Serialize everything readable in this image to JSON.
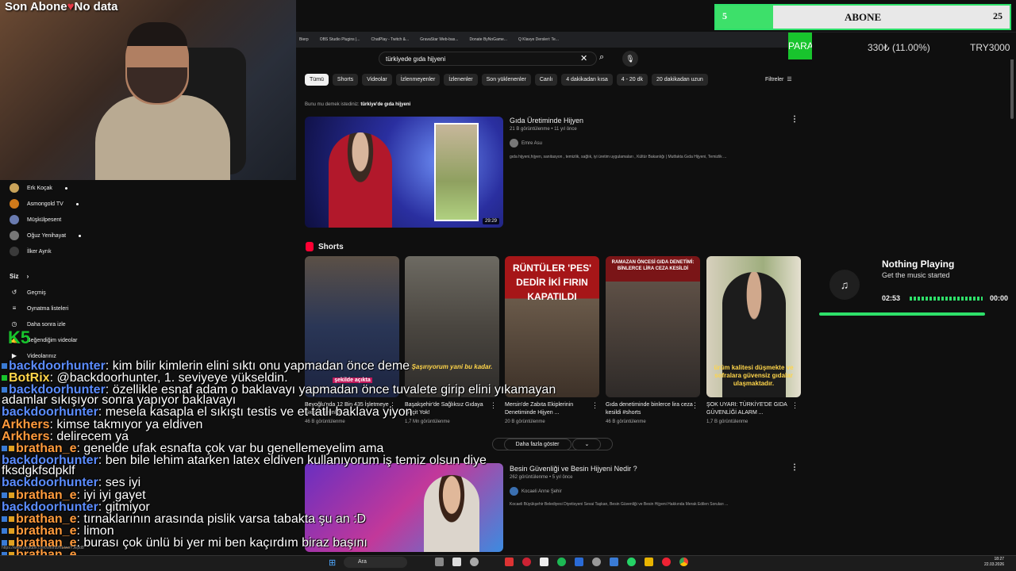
{
  "overlay": {
    "title_left": "Son Abone",
    "title_right": "No data"
  },
  "browser": {
    "bookmarks": [
      "Bierp",
      "OBS Studio Plugins |...",
      "ChatPlay - Twitch &...",
      "GravaStar Web-bas...",
      "Donate ByNoGame...",
      "Q Klavye Dersleri: Te..."
    ]
  },
  "youtube": {
    "search": {
      "value": "türkiyede gıda hijyeni"
    },
    "chips": [
      "Tümü",
      "Shorts",
      "Videolar",
      "İzlenmeyenler",
      "İzlenenler",
      "Son yüklenenler",
      "Canlı",
      "4 dakikadan kısa",
      "4 - 20 dk",
      "20 dakikadan uzun"
    ],
    "filters_label": "Filtreler",
    "did_you_mean_prefix": "Bunu mu demek istediniz:",
    "did_you_mean_query": "türkiye'de gıda hijyeni",
    "result1": {
      "title": "Gıda Üretiminde Hijyen",
      "meta": "21 B görüntülenme • 11 yıl önce",
      "channel": "Emre Asu",
      "description": "gıda hijyeni,hijyen, sanitasyon , temizlik, sağlık, iyi üretim uygulamaları , Kültür Bakanlığı | Mutfakta Gıda Hijyeni, Temizlik ...",
      "duration": "29:29"
    },
    "shorts_label": "Shorts",
    "shorts": [
      {
        "title": "Beyoğlu'nda 12 Bin 435 İşletmeye Gıda Güvenliği ...",
        "views": "46 B görüntülenme",
        "caption": "şekilde açıkta"
      },
      {
        "title": "Başakşehir'de Sağlıksız Gıdaya Geçit Yok!",
        "views": "1,7 Mn görüntülenme",
        "caption": "Şaşırıyorum yani bu kadar."
      },
      {
        "title": "Mersin'de Zabıta Ekiplerinin Denetiminde Hijyen ...",
        "views": "20 B görüntülenme",
        "caption": "RÜNTÜLER 'PES' DEDİR İKİ FIRIN KAPATILDI"
      },
      {
        "title": "Gıda denetiminde binlerce lira ceza kesildi #shorts",
        "views": "46 B görüntülenme",
        "caption": "RAMAZAN ÖNCESİ GIDA DENETİMİ: BİNLERCE LİRA CEZA KESİLDİ"
      },
      {
        "title": "ŞOK UYARI: TÜRKİYE'DE GIDA GÜVENLİĞİ ALARM ...",
        "views": "1,7 B görüntülenme",
        "caption": "ürüm kalitesi düşmekte ve sofralara güvensiz gıdalar ulaşmaktadır."
      }
    ],
    "show_more": "Daha fazla göster",
    "result2": {
      "title": "Besin Güvenliği ve Besin Hijyeni Nedir ?",
      "meta": "262 görüntülenme • 5 yıl önce",
      "channel": "Kocaeli Anne Şehir",
      "description": "Kocaeli Büyükşehir Belediyesi Diyetisyeni Sevai Taşkan, Besin Güvenliği ve Besin Hijyeni Hakkında Merak Edilen Soruları ..."
    }
  },
  "sidebar": {
    "subscriptions": [
      "Erk Koçak",
      "Asmongold TV",
      "Müşkülpesent",
      "Oğuz Yenihayat",
      "İlker Ayrık"
    ],
    "you_label": "Siz",
    "you_items": [
      "Geçmiş",
      "Oynatma listeleri",
      "Daha sonra izle",
      "Beğendiğim videolar",
      "Videolarınız"
    ]
  },
  "chat": [
    {
      "user": "backdoorhunter",
      "msg": ": kim bilir kimlerin elini sıktı onu yapmadan önce deme",
      "color": "#5b8cff"
    },
    {
      "user": "BotRix",
      "msg": ": @backdoorhunter, 1. seviyeye yükseldin.",
      "color": "#ffd54a"
    },
    {
      "user": "backdoorhunter",
      "msg": ": özellikle esnaf adam o baklavayı yapmadan önce tuvalete girip elini yıkamayan",
      "color": "#5b8cff"
    },
    {
      "user": "",
      "msg": "adamlar sıkışıyor sonra yapıyor baklavayı",
      "color": "#ffffff"
    },
    {
      "user": "backdoorhunter",
      "msg": ": mesela kasapla el sıkıştı testis ve et tatlı baklava yiyon",
      "color": "#5b8cff"
    },
    {
      "user": "Arkhers",
      "msg": ": kimse takmıyor ya eldiven",
      "color": "#ff9a3c"
    },
    {
      "user": "Arkhers",
      "msg": ": delirecem ya",
      "color": "#ff9a3c"
    },
    {
      "user": "brathan_e",
      "msg": ": genelde ufak esnafta çok var bu genellemeyelim ama",
      "color": "#ff9a3c"
    },
    {
      "user": "backdoorhunter",
      "msg": ": ben bile lehim atarken latex eldiven kullanıyorum iş temiz olsun diye",
      "color": "#5b8cff"
    },
    {
      "user": "",
      "msg": "fksdgkfsdpklf",
      "color": "#ffffff"
    },
    {
      "user": "backdoorhunter",
      "msg": ": ses iyi",
      "color": "#5b8cff"
    },
    {
      "user": "brathan_e",
      "msg": ": iyi iyi gayet",
      "color": "#ff9a3c"
    },
    {
      "user": "backdoorhunter",
      "msg": ": gitmiyor",
      "color": "#5b8cff"
    },
    {
      "user": "brathan_e",
      "msg": ": tırnaklarının arasında pislik varsa tabakta şu an :D",
      "color": "#ff9a3c"
    },
    {
      "user": "brathan_e",
      "msg": ": limon",
      "color": "#ff9a3c"
    },
    {
      "user": "brathan_e",
      "msg": ": burası çok ünlü bi yer mi ben kaçırdım biraz başını",
      "color": "#ff9a3c"
    },
    {
      "user": "brathan_e",
      "msg": "",
      "color": "#ff9a3c"
    }
  ],
  "k5": "K5",
  "subgoal": {
    "current": "5",
    "label": "ABONE",
    "goal": "25",
    "progress": 0.2
  },
  "ticker": {
    "name": "PARA :)",
    "price": "330₺ (11.00%)",
    "currency": "TRY3000"
  },
  "music": {
    "title": "Nothing Playing",
    "subtitle": "Get the music started",
    "elapsed": "02:53",
    "remaining": "00:00"
  },
  "status_url": "https://www.youtube.com/shorts/NLtwoYJEpd8",
  "taskbar": {
    "search": "Ara",
    "time": "18:27",
    "date": "22.03.2026"
  }
}
